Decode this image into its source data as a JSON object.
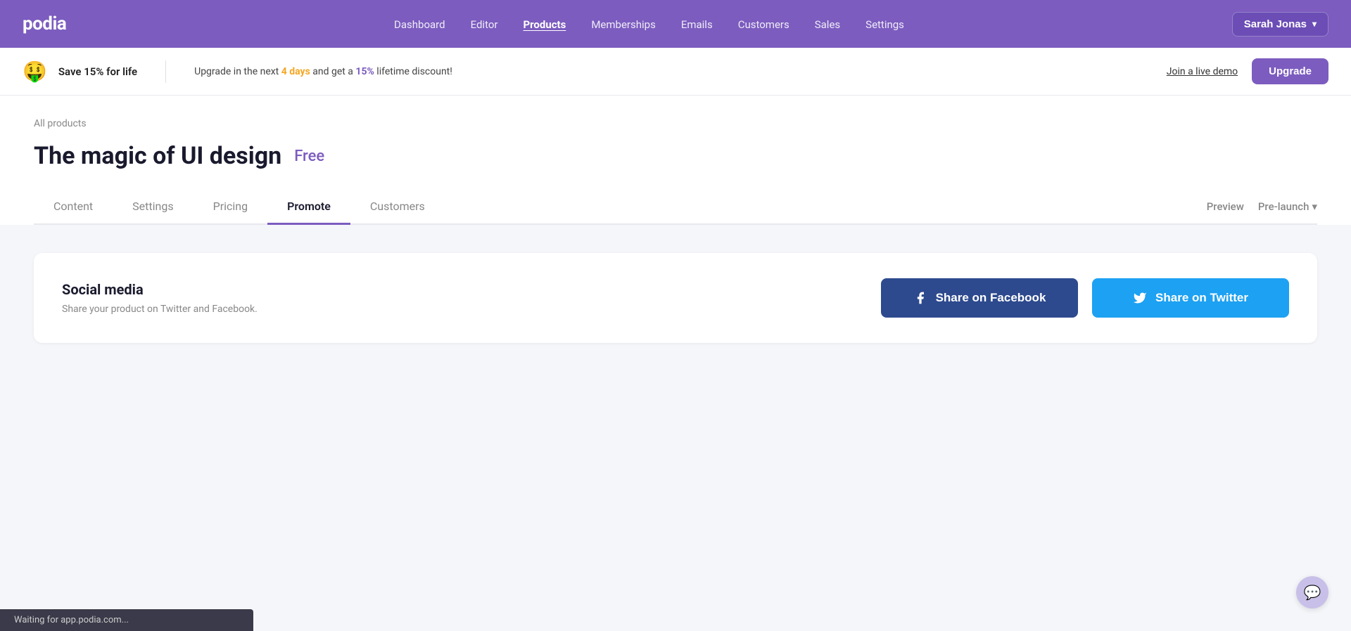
{
  "brand": {
    "name": "podia"
  },
  "navbar": {
    "links": [
      {
        "label": "Dashboard",
        "active": false
      },
      {
        "label": "Editor",
        "active": false
      },
      {
        "label": "Products",
        "active": true
      },
      {
        "label": "Memberships",
        "active": false
      },
      {
        "label": "Emails",
        "active": false
      },
      {
        "label": "Customers",
        "active": false
      },
      {
        "label": "Sales",
        "active": false
      },
      {
        "label": "Settings",
        "active": false
      }
    ],
    "user_button": "Sarah Jonas",
    "chevron": "▾"
  },
  "banner": {
    "emoji": "🤑",
    "save_text": "Save 15% for life",
    "upgrade_text_before": "Upgrade in the next ",
    "upgrade_days": "4 days",
    "upgrade_text_mid": " and get a ",
    "upgrade_pct": "15%",
    "upgrade_text_after": " lifetime discount!",
    "demo_link": "Join a live demo",
    "upgrade_btn": "Upgrade"
  },
  "breadcrumb": "All products",
  "page": {
    "title": "The magic of UI design",
    "badge": "Free"
  },
  "tabs": [
    {
      "label": "Content",
      "active": false
    },
    {
      "label": "Settings",
      "active": false
    },
    {
      "label": "Pricing",
      "active": false
    },
    {
      "label": "Promote",
      "active": true
    },
    {
      "label": "Customers",
      "active": false
    }
  ],
  "tab_actions": [
    {
      "label": "Preview",
      "arrow": false
    },
    {
      "label": "Pre-launch",
      "arrow": true
    }
  ],
  "social_card": {
    "title": "Social media",
    "description": "Share your product on Twitter and Facebook.",
    "fb_btn": "Share on Facebook",
    "tw_btn": "Share on Twitter"
  },
  "status_bar": {
    "text": "Waiting for app.podia.com..."
  }
}
